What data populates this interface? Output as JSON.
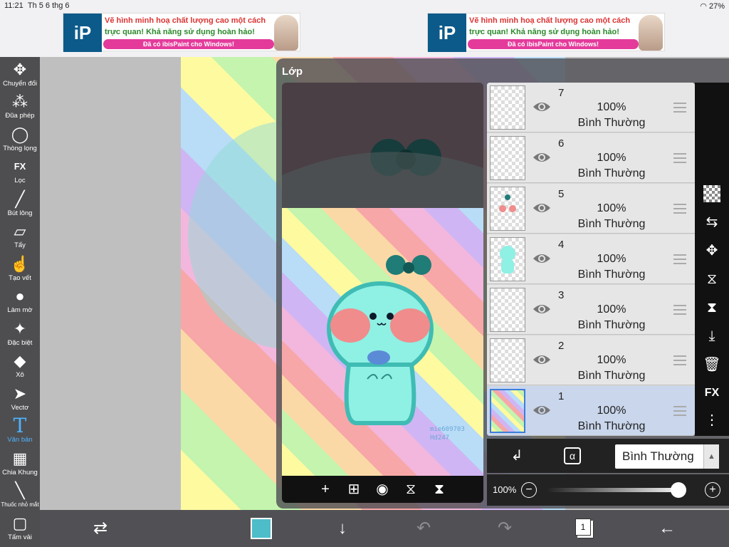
{
  "status_bar": {
    "time": "11:21",
    "date": "Th 5 6 thg 6",
    "battery": "27%"
  },
  "ads": [
    {
      "line1": "Vẽ hình minh hoạ chất lượng cao một cách",
      "line2": "trực quan! Khả năng sử dụng hoàn hảo!",
      "button": "Đã có ibisPaint cho Windows!"
    },
    {
      "line1": "Vẽ hình minh hoạ chất lượng cao một cách",
      "line2": "trực quan! Khả năng sử dụng hoàn hảo!",
      "button": "Đã có ibisPaint cho Windows!"
    }
  ],
  "tools": [
    {
      "label": "Chuyển đổi",
      "icon": "move-icon",
      "glyph": "✥"
    },
    {
      "label": "Đũa phép",
      "icon": "magic-wand-icon",
      "glyph": "⁂"
    },
    {
      "label": "Thòng lọng",
      "icon": "lasso-icon",
      "glyph": "◯"
    },
    {
      "label": "Lọc",
      "icon": "filter-fx-icon",
      "glyph": "FX"
    },
    {
      "label": "Bút lông",
      "icon": "brush-icon",
      "glyph": "╱"
    },
    {
      "label": "Tẩy",
      "icon": "eraser-icon",
      "glyph": "▱"
    },
    {
      "label": "Tạo vết",
      "icon": "smudge-icon",
      "glyph": "☝"
    },
    {
      "label": "Làm mờ",
      "icon": "blur-drop-icon",
      "glyph": "💧"
    },
    {
      "label": "Đặc biệt",
      "icon": "special-brush-icon",
      "glyph": "✦"
    },
    {
      "label": "Xô",
      "icon": "bucket-icon",
      "glyph": "◆"
    },
    {
      "label": "Vectơ",
      "icon": "vector-cursor-icon",
      "glyph": "➤"
    },
    {
      "label": "Văn bản",
      "icon": "text-icon",
      "glyph": "T"
    },
    {
      "label": "Chia Khung",
      "icon": "frame-divider-icon",
      "glyph": "▦"
    },
    {
      "label": "Thuốc nhỏ mắt",
      "icon": "eyedropper-icon",
      "glyph": "╲"
    },
    {
      "label": "Tấm vải",
      "icon": "canvas-icon",
      "glyph": "▢"
    }
  ],
  "layer_panel": {
    "title": "Lớp",
    "watermark": [
      "mie609703",
      "Hd247"
    ],
    "layers": [
      {
        "number": "7",
        "opacity": "100%",
        "blend": "Bình Thường"
      },
      {
        "number": "6",
        "opacity": "100%",
        "blend": "Bình Thường"
      },
      {
        "number": "5",
        "opacity": "100%",
        "blend": "Bình Thường"
      },
      {
        "number": "4",
        "opacity": "100%",
        "blend": "Bình Thường"
      },
      {
        "number": "3",
        "opacity": "100%",
        "blend": "Bình Thường"
      },
      {
        "number": "2",
        "opacity": "100%",
        "blend": "Bình Thường"
      },
      {
        "number": "1",
        "opacity": "100%",
        "blend": "Bình Thường",
        "selected": true
      }
    ],
    "blend_mode": "Bình Thường",
    "opacity_label": "100%",
    "opacity_value": 1.0,
    "side_fx_label": "FX",
    "alpha_lock_label": "α"
  },
  "colors": {
    "accent": "#4fb3ff",
    "current_color": "#4dbdc9",
    "selected_layer": "#c9d6ec"
  }
}
